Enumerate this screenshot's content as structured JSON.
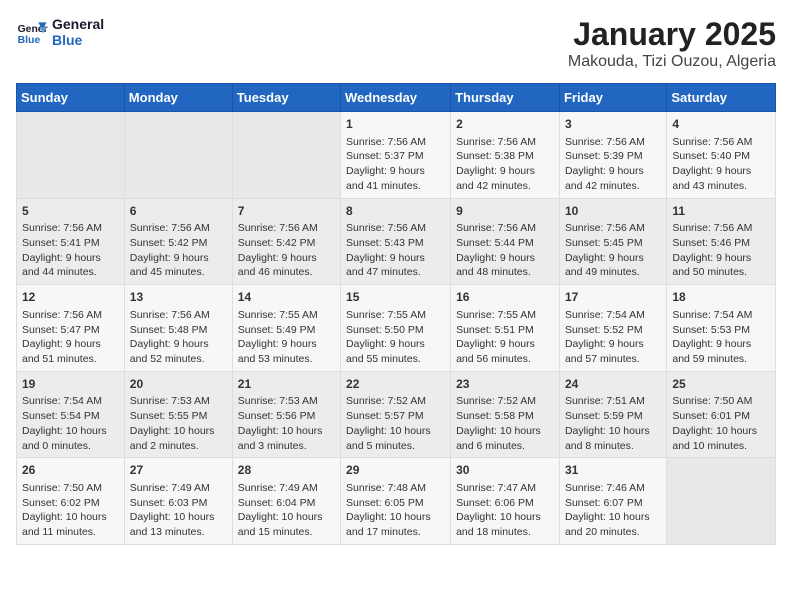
{
  "header": {
    "logo_line1": "General",
    "logo_line2": "Blue",
    "title": "January 2025",
    "subtitle": "Makouda, Tizi Ouzou, Algeria"
  },
  "calendar": {
    "days_of_week": [
      "Sunday",
      "Monday",
      "Tuesday",
      "Wednesday",
      "Thursday",
      "Friday",
      "Saturday"
    ],
    "weeks": [
      [
        {
          "day": "",
          "content": ""
        },
        {
          "day": "",
          "content": ""
        },
        {
          "day": "",
          "content": ""
        },
        {
          "day": "1",
          "content": "Sunrise: 7:56 AM\nSunset: 5:37 PM\nDaylight: 9 hours\nand 41 minutes."
        },
        {
          "day": "2",
          "content": "Sunrise: 7:56 AM\nSunset: 5:38 PM\nDaylight: 9 hours\nand 42 minutes."
        },
        {
          "day": "3",
          "content": "Sunrise: 7:56 AM\nSunset: 5:39 PM\nDaylight: 9 hours\nand 42 minutes."
        },
        {
          "day": "4",
          "content": "Sunrise: 7:56 AM\nSunset: 5:40 PM\nDaylight: 9 hours\nand 43 minutes."
        }
      ],
      [
        {
          "day": "5",
          "content": "Sunrise: 7:56 AM\nSunset: 5:41 PM\nDaylight: 9 hours\nand 44 minutes."
        },
        {
          "day": "6",
          "content": "Sunrise: 7:56 AM\nSunset: 5:42 PM\nDaylight: 9 hours\nand 45 minutes."
        },
        {
          "day": "7",
          "content": "Sunrise: 7:56 AM\nSunset: 5:42 PM\nDaylight: 9 hours\nand 46 minutes."
        },
        {
          "day": "8",
          "content": "Sunrise: 7:56 AM\nSunset: 5:43 PM\nDaylight: 9 hours\nand 47 minutes."
        },
        {
          "day": "9",
          "content": "Sunrise: 7:56 AM\nSunset: 5:44 PM\nDaylight: 9 hours\nand 48 minutes."
        },
        {
          "day": "10",
          "content": "Sunrise: 7:56 AM\nSunset: 5:45 PM\nDaylight: 9 hours\nand 49 minutes."
        },
        {
          "day": "11",
          "content": "Sunrise: 7:56 AM\nSunset: 5:46 PM\nDaylight: 9 hours\nand 50 minutes."
        }
      ],
      [
        {
          "day": "12",
          "content": "Sunrise: 7:56 AM\nSunset: 5:47 PM\nDaylight: 9 hours\nand 51 minutes."
        },
        {
          "day": "13",
          "content": "Sunrise: 7:56 AM\nSunset: 5:48 PM\nDaylight: 9 hours\nand 52 minutes."
        },
        {
          "day": "14",
          "content": "Sunrise: 7:55 AM\nSunset: 5:49 PM\nDaylight: 9 hours\nand 53 minutes."
        },
        {
          "day": "15",
          "content": "Sunrise: 7:55 AM\nSunset: 5:50 PM\nDaylight: 9 hours\nand 55 minutes."
        },
        {
          "day": "16",
          "content": "Sunrise: 7:55 AM\nSunset: 5:51 PM\nDaylight: 9 hours\nand 56 minutes."
        },
        {
          "day": "17",
          "content": "Sunrise: 7:54 AM\nSunset: 5:52 PM\nDaylight: 9 hours\nand 57 minutes."
        },
        {
          "day": "18",
          "content": "Sunrise: 7:54 AM\nSunset: 5:53 PM\nDaylight: 9 hours\nand 59 minutes."
        }
      ],
      [
        {
          "day": "19",
          "content": "Sunrise: 7:54 AM\nSunset: 5:54 PM\nDaylight: 10 hours\nand 0 minutes."
        },
        {
          "day": "20",
          "content": "Sunrise: 7:53 AM\nSunset: 5:55 PM\nDaylight: 10 hours\nand 2 minutes."
        },
        {
          "day": "21",
          "content": "Sunrise: 7:53 AM\nSunset: 5:56 PM\nDaylight: 10 hours\nand 3 minutes."
        },
        {
          "day": "22",
          "content": "Sunrise: 7:52 AM\nSunset: 5:57 PM\nDaylight: 10 hours\nand 5 minutes."
        },
        {
          "day": "23",
          "content": "Sunrise: 7:52 AM\nSunset: 5:58 PM\nDaylight: 10 hours\nand 6 minutes."
        },
        {
          "day": "24",
          "content": "Sunrise: 7:51 AM\nSunset: 5:59 PM\nDaylight: 10 hours\nand 8 minutes."
        },
        {
          "day": "25",
          "content": "Sunrise: 7:50 AM\nSunset: 6:01 PM\nDaylight: 10 hours\nand 10 minutes."
        }
      ],
      [
        {
          "day": "26",
          "content": "Sunrise: 7:50 AM\nSunset: 6:02 PM\nDaylight: 10 hours\nand 11 minutes."
        },
        {
          "day": "27",
          "content": "Sunrise: 7:49 AM\nSunset: 6:03 PM\nDaylight: 10 hours\nand 13 minutes."
        },
        {
          "day": "28",
          "content": "Sunrise: 7:49 AM\nSunset: 6:04 PM\nDaylight: 10 hours\nand 15 minutes."
        },
        {
          "day": "29",
          "content": "Sunrise: 7:48 AM\nSunset: 6:05 PM\nDaylight: 10 hours\nand 17 minutes."
        },
        {
          "day": "30",
          "content": "Sunrise: 7:47 AM\nSunset: 6:06 PM\nDaylight: 10 hours\nand 18 minutes."
        },
        {
          "day": "31",
          "content": "Sunrise: 7:46 AM\nSunset: 6:07 PM\nDaylight: 10 hours\nand 20 minutes."
        },
        {
          "day": "",
          "content": ""
        }
      ]
    ]
  }
}
